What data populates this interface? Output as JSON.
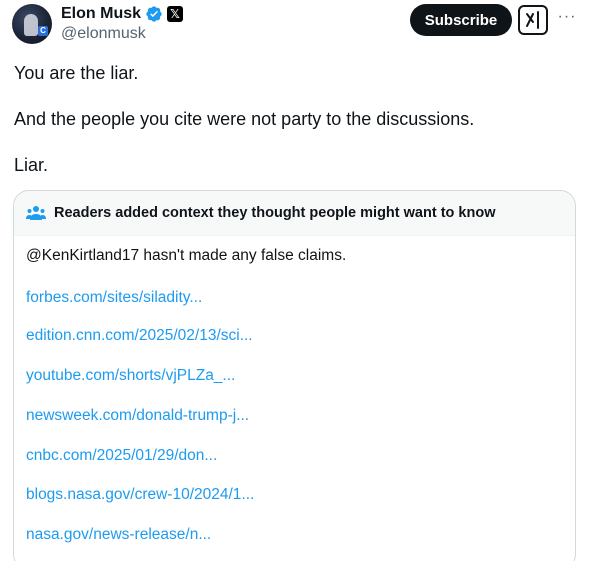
{
  "author": {
    "display_name": "Elon Musk",
    "handle": "@elonmusk",
    "x_badge": "𝕏",
    "avatar_badge": "C"
  },
  "actions": {
    "subscribe_label": "Subscribe",
    "more_label": "···"
  },
  "tweet": {
    "lines": [
      "You are the liar.",
      "And the people you cite were not party to the discussions.",
      "Liar."
    ]
  },
  "community_note": {
    "title": "Readers added context they thought people might want to know",
    "body": "@KenKirtland17 hasn't made any false claims.",
    "links": [
      "forbes.com/sites/siladity...",
      "edition.cnn.com/2025/02/13/sci...",
      "youtube.com/shorts/vjPLZa_...",
      "newsweek.com/donald-trump-j...",
      "cnbc.com/2025/01/29/don...",
      "blogs.nasa.gov/crew-10/2024/1...",
      "nasa.gov/news-release/n..."
    ]
  },
  "colors": {
    "link": "#1d9bf0",
    "verified": "#1d9bf0",
    "text": "#0f1419",
    "secondary": "#536471",
    "note_header_bg": "#f7f9f9",
    "note_border": "#cfd9de"
  },
  "icons": {
    "verified": "verified-badge-icon",
    "x_logo": "x-logo-icon",
    "grok": "grok-icon",
    "more": "more-dots-icon",
    "people": "people-icon"
  }
}
